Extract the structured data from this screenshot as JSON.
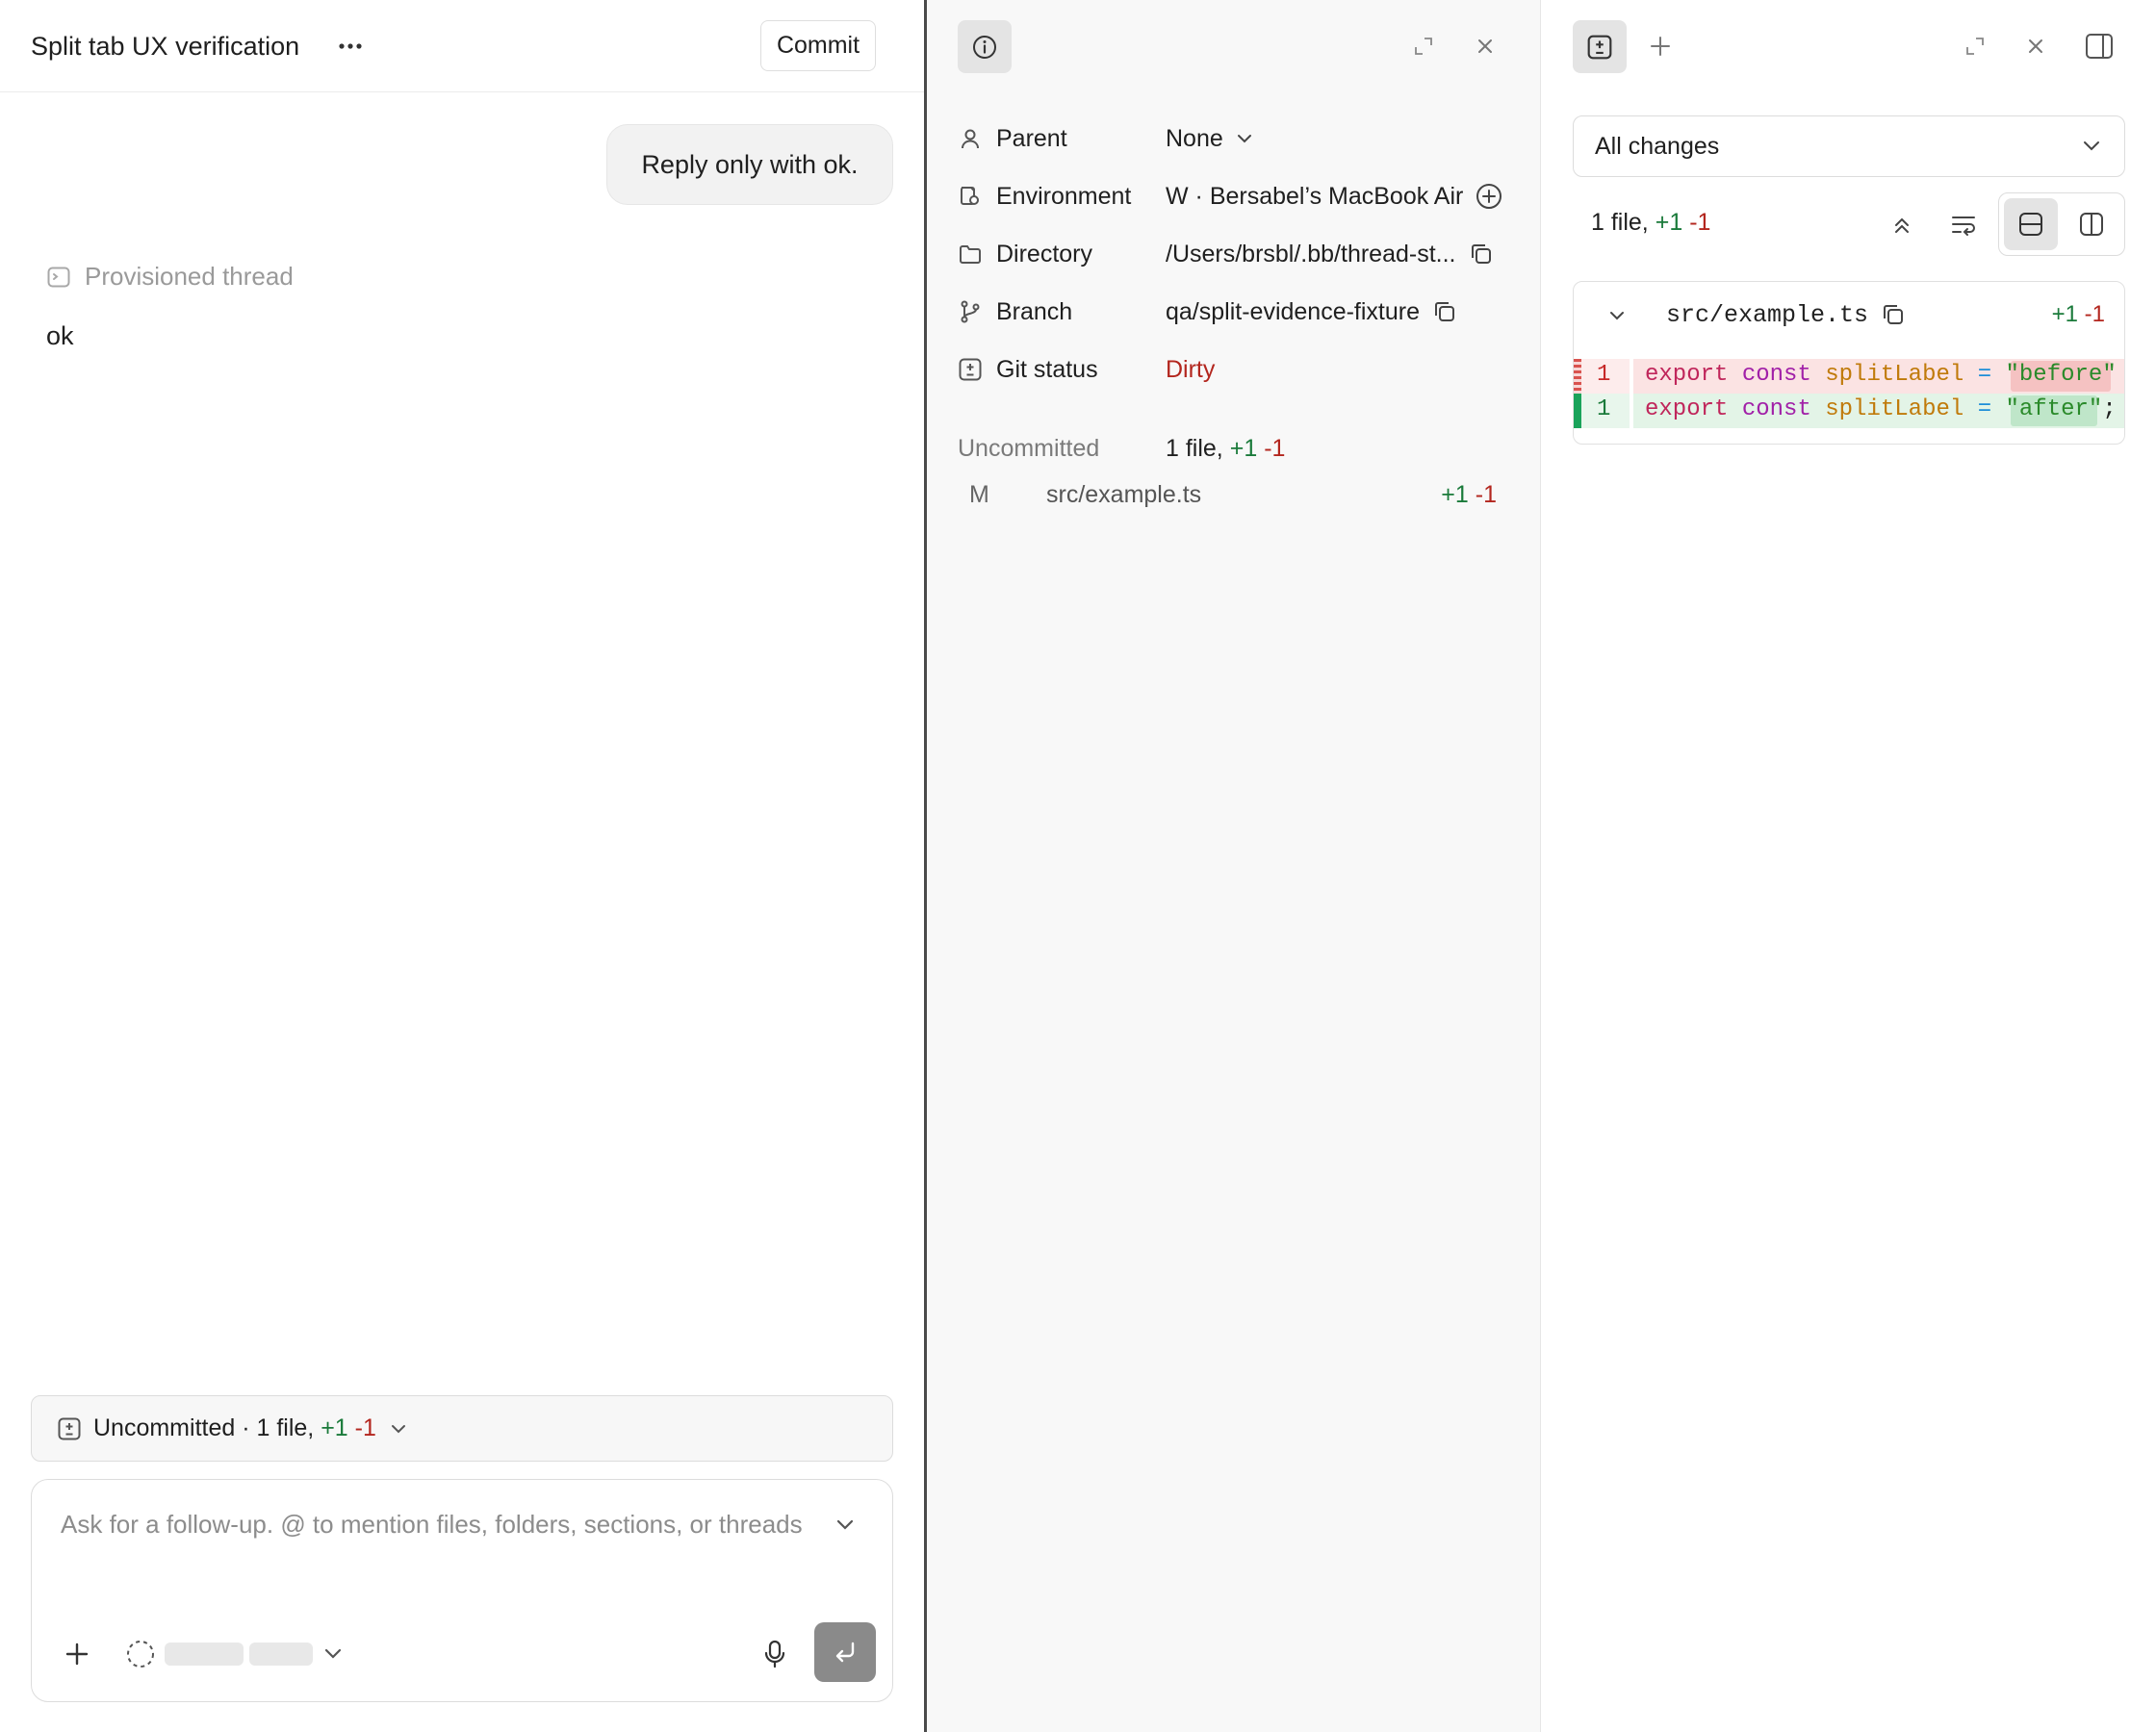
{
  "thread": {
    "title": "Split tab UX verification",
    "commit_label": "Commit",
    "user_message": "Reply only with ok.",
    "provisioned_label": "Provisioned thread",
    "assistant_reply": "ok"
  },
  "uncommitted_bar": {
    "prefix": "Uncommitted · 1 file,",
    "added": "+1",
    "removed": "-1"
  },
  "composer": {
    "placeholder": "Ask for a follow-up. @ to mention files, folders, sections, or threads",
    "value": ""
  },
  "info_panel": {
    "parent_label": "Parent",
    "parent_value": "None",
    "environment_label": "Environment",
    "environment_value": "W · Bersabel’s MacBook Air",
    "directory_label": "Directory",
    "directory_value": "/Users/brsbl/.bb/thread-st...",
    "branch_label": "Branch",
    "branch_value": "qa/split-evidence-fixture",
    "git_status_label": "Git status",
    "git_status_value": "Dirty",
    "uncommitted_label": "Uncommitted",
    "uncommitted_summary": "1 file,",
    "uncommitted_added": "+1",
    "uncommitted_removed": "-1",
    "files": [
      {
        "status": "M",
        "path": "src/example.ts",
        "added": "+1",
        "removed": "-1"
      }
    ]
  },
  "diff_panel": {
    "filter_label": "All changes",
    "summary_prefix": "1 file,",
    "summary_added": "+1",
    "summary_removed": "-1",
    "file_name": "src/example.ts",
    "file_added": "+1",
    "file_removed": "-1",
    "lines": [
      {
        "type": "removed",
        "line_no": "1",
        "code": "export const splitLabel = \"before\""
      },
      {
        "type": "added",
        "line_no": "1",
        "code": "export const splitLabel = \"after\";"
      }
    ]
  },
  "colors": {
    "added": "#1a7a3a",
    "removed": "#b3261e",
    "dirty": "#b3261e"
  }
}
